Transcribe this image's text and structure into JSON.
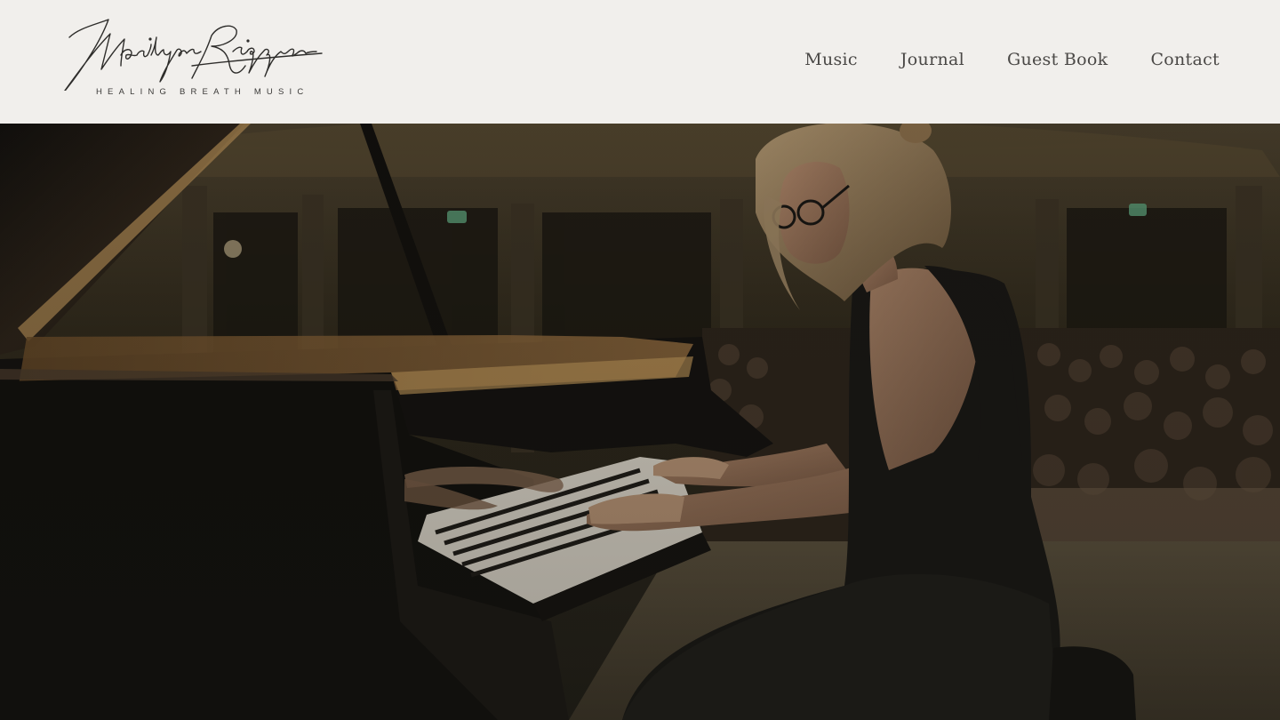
{
  "brand": {
    "script_name": "Marilyn Riggien",
    "tagline": "HEALING BREATH MUSIC"
  },
  "nav": {
    "items": [
      {
        "label": "Music"
      },
      {
        "label": "Journal"
      },
      {
        "label": "Guest Book"
      },
      {
        "label": "Contact"
      }
    ]
  },
  "colors": {
    "header_bg": "#f1efec",
    "nav_text": "#4a4846",
    "hero_tint": "#1b1a15"
  }
}
